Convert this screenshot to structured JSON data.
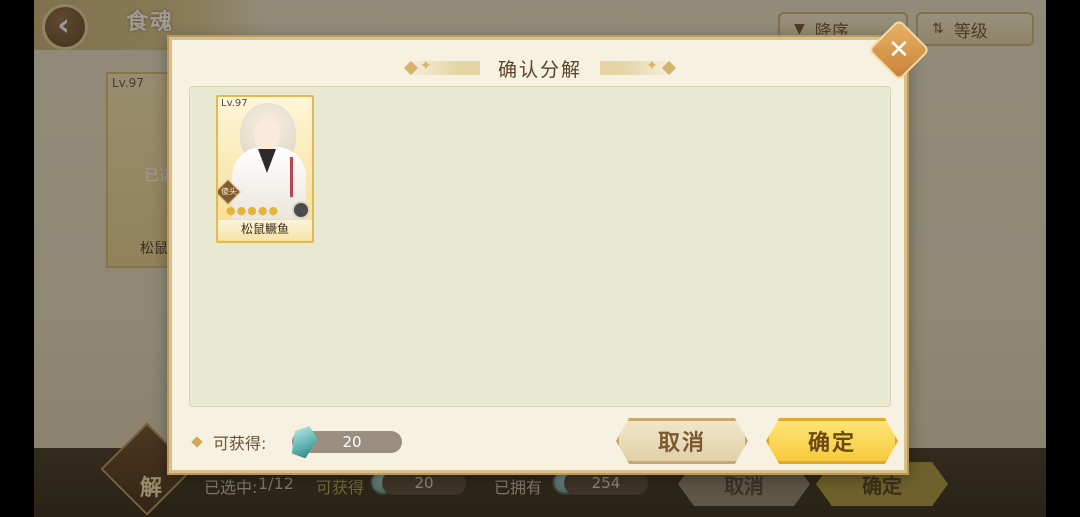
{
  "background": {
    "title": "食魂",
    "sort_order_label": "降序",
    "sort_field_label": "等级",
    "card_level": "Lv.97",
    "card_selected": "已选",
    "card_name": "松鼠",
    "bottom_bar": {
      "selected_label": "已选中:",
      "selected_count": "1/12",
      "obtain_label": "可获得",
      "obtain_value": "20",
      "owned_label": "已拥有",
      "owned_value": "254",
      "cancel_label": "取消",
      "confirm_label": "确定",
      "decompose_label": "解"
    }
  },
  "modal": {
    "title": "确认分解",
    "close_icon": "close-x-icon",
    "cards": [
      {
        "level": "Lv.97",
        "name": "松鼠鳜鱼",
        "stars": 5,
        "badge": "傻头"
      }
    ],
    "reward": {
      "label": "可获得:",
      "value": "20",
      "icon": "crystal-gem-icon"
    },
    "cancel_label": "取消",
    "confirm_label": "确定"
  },
  "colors": {
    "modal_bg": "#f6f1e1",
    "content_bg": "#e9e8d1",
    "confirm_yellow": "#f6c83a",
    "close_orange": "#d99346"
  }
}
